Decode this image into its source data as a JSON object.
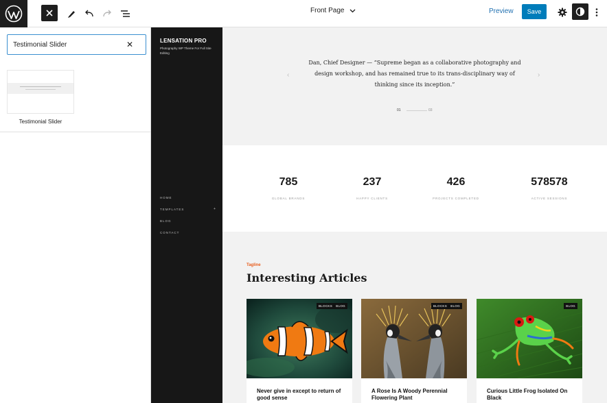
{
  "topbar": {
    "doc_title": "Front Page",
    "preview_label": "Preview",
    "save_label": "Save"
  },
  "inserter": {
    "search_value": "Testimonial Slider",
    "result_label": "Testimonial Slider"
  },
  "site": {
    "title": "LENSATION PRO",
    "tagline": "Photography WP Theme For Full Site Editing",
    "nav": [
      "HOME",
      "TEMPLATES",
      "BLOG",
      "CONTACT"
    ],
    "nav_plus": "+"
  },
  "testimonial": {
    "quote": "Dan, Chief Designer — “Supreme began as a collaborative photography and design workshop, and has remained true to its trans-disciplinary way of thinking since its inception.”",
    "prev_arrow": "‹",
    "next_arrow": "›",
    "current_page": "01",
    "total_pages": "03"
  },
  "stats": [
    {
      "value": "785",
      "label": "GLOBAL BRANDS"
    },
    {
      "value": "237",
      "label": "HAPPY CLIENTS"
    },
    {
      "value": "426",
      "label": "PROJECTS COMPLETED"
    },
    {
      "value": "578578",
      "label": "ACTIVE SESSIONS"
    }
  ],
  "articles": {
    "tagline": "Tagline",
    "title": "Interesting Articles",
    "cards": [
      {
        "title": "Never give in except to return of good sense",
        "badges": [
          "BLOCKS",
          "BLOG"
        ],
        "image": "clownfish"
      },
      {
        "title": "A Rose Is A Woody Perennial Flowering Plant",
        "badges": [
          "BLOCKS",
          "BLOG"
        ],
        "image": "crowned-cranes"
      },
      {
        "title": "Curious Little Frog Isolated On Black",
        "badges": [
          "BLOG"
        ],
        "image": "tree-frog"
      }
    ]
  },
  "colors": {
    "accent": "#007cba",
    "tagline": "#e85d1c",
    "dark": "#171717"
  }
}
